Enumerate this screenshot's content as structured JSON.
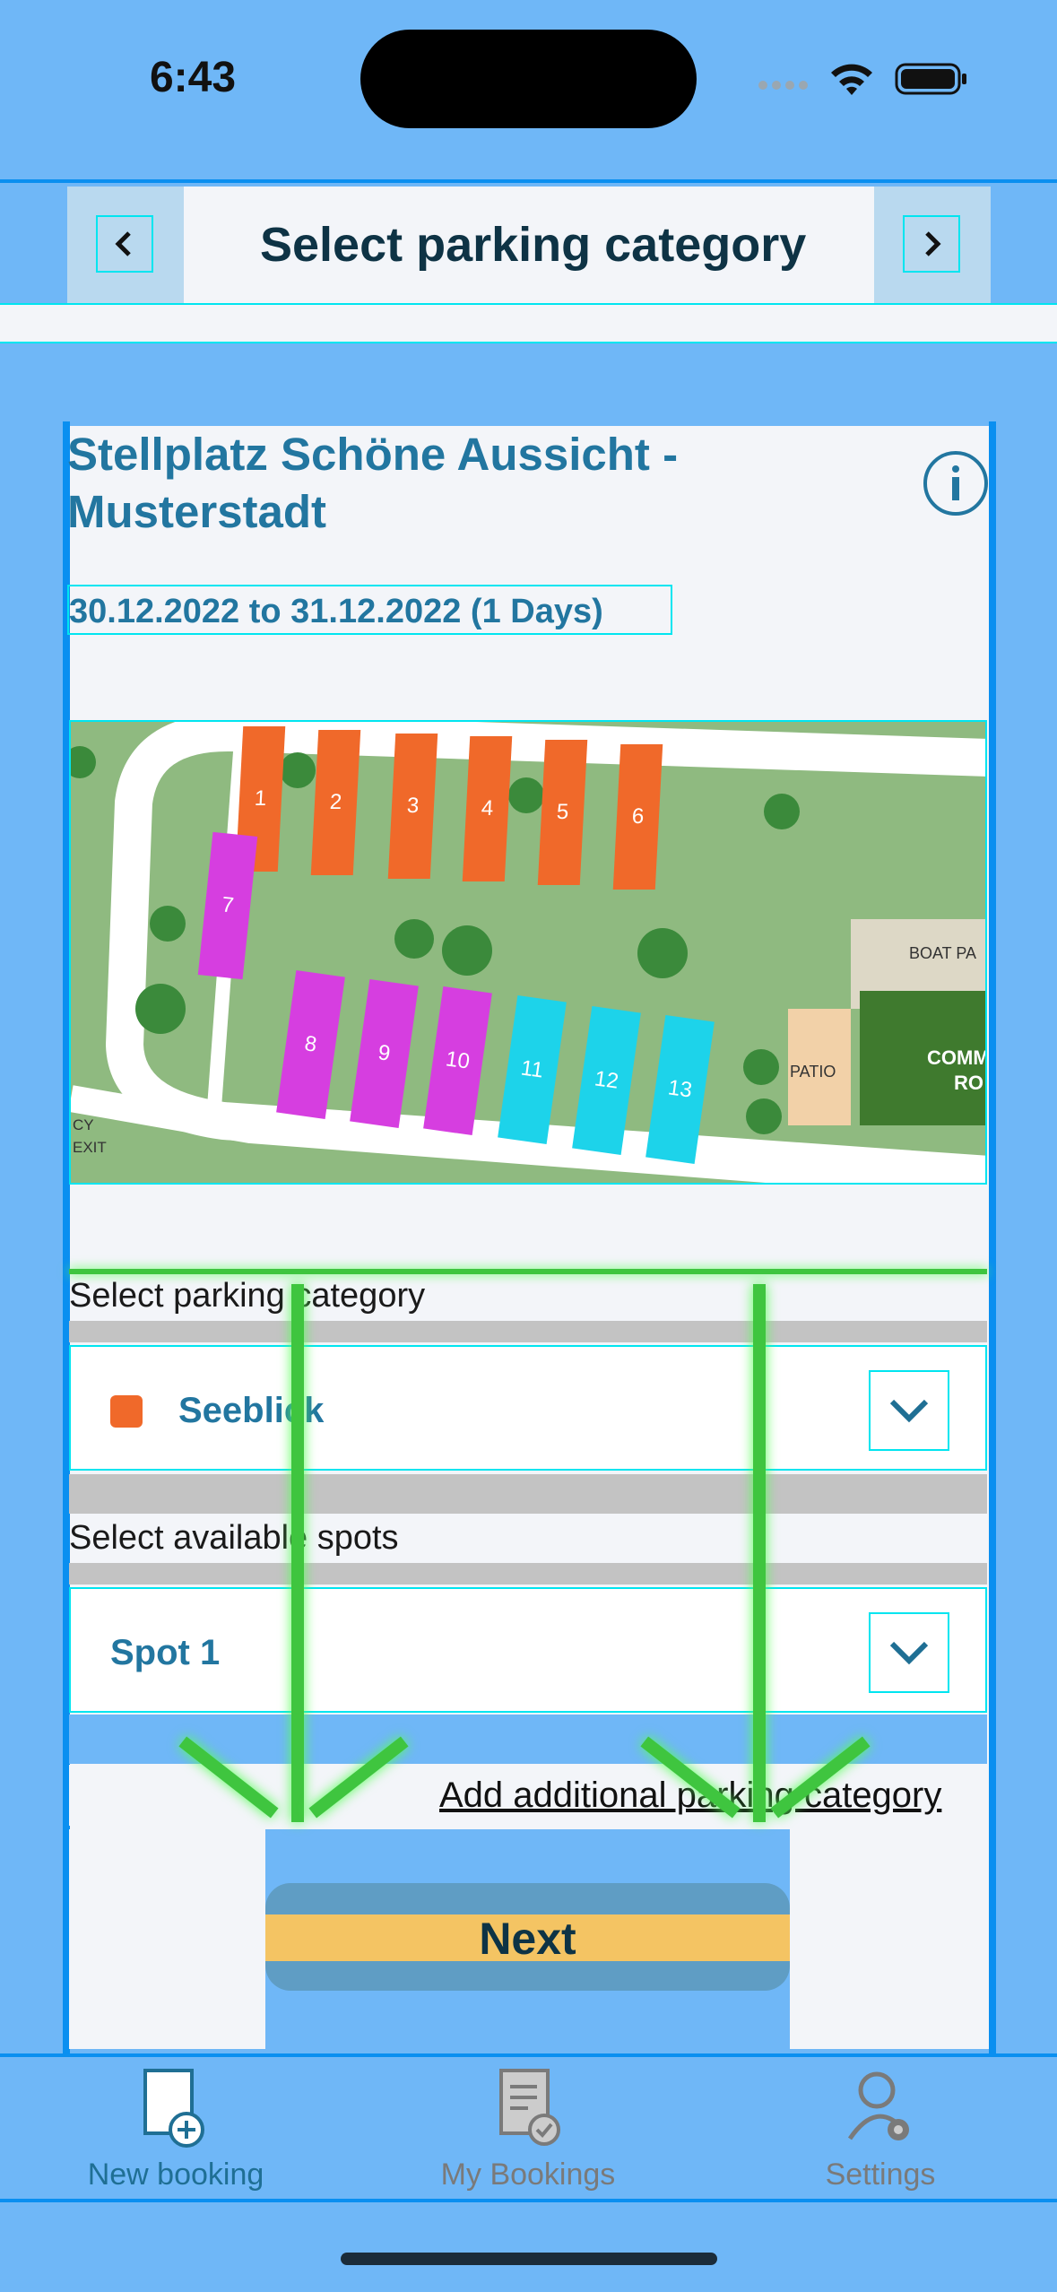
{
  "status_bar": {
    "time": "6:43"
  },
  "header": {
    "title": "Select parking category",
    "prev_icon": "chevron-left-icon",
    "next_icon": "chevron-right-icon"
  },
  "location": {
    "name": "Stellplatz Schöne Aussicht - Musterstadt",
    "dates": "30.12.2022 to 31.12.2022 (1 Days)",
    "info_icon": "info-icon"
  },
  "map": {
    "spots": [
      "1",
      "2",
      "3",
      "4",
      "5",
      "6",
      "7",
      "8",
      "9",
      "10",
      "11",
      "12",
      "13"
    ],
    "labels": {
      "patio": "PATIO",
      "boat": "BOAT PA",
      "common_1": "COMM",
      "common_2": "RO",
      "exit_1": "CY",
      "exit_2": "EXIT"
    },
    "colors": {
      "orange": "#f0692a",
      "magenta": "#d63ee0",
      "cyan": "#1dd3ea",
      "grass": "#8fba80"
    }
  },
  "form": {
    "category_label": "Select parking category",
    "category_value": "Seeblick",
    "category_color": "#f0692a",
    "spots_label": "Select available spots",
    "spot_value": "Spot 1",
    "add_link": "Add additional parking category",
    "next_label": "Next"
  },
  "tabbar": {
    "items": [
      {
        "label": "New booking",
        "icon": "new-booking-icon",
        "active": true
      },
      {
        "label": "My Bookings",
        "icon": "bookings-icon",
        "active": false
      },
      {
        "label": "Settings",
        "icon": "settings-icon",
        "active": false
      }
    ]
  }
}
